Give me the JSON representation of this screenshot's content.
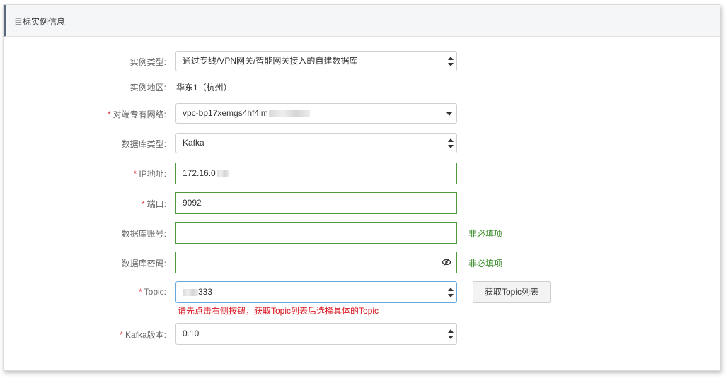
{
  "panel": {
    "title": "目标实例信息"
  },
  "form": {
    "instance_type": {
      "label": "实例类型:",
      "value": "通过专线/VPN网关/智能网关接入的自建数据库"
    },
    "region": {
      "label": "实例地区:",
      "value": "华东1（杭州）"
    },
    "vpc": {
      "required": "*",
      "label": "对端专有网络:",
      "value": "vpc-bp17xemgs4hf4lm"
    },
    "db_type": {
      "label": "数据库类型:",
      "value": "Kafka"
    },
    "ip": {
      "required": "*",
      "label": "IP地址:",
      "value": "172.16.0"
    },
    "port": {
      "required": "*",
      "label": "端口:",
      "value": "9092"
    },
    "account": {
      "label": "数据库账号:",
      "value": "",
      "hint": "非必填项"
    },
    "password": {
      "label": "数据库密码:",
      "value": "",
      "hint": "非必填项"
    },
    "topic": {
      "required": "*",
      "label": "Topic:",
      "value": "333",
      "button": "获取Topic列表",
      "error": "请先点击右侧按钮，获取Topic列表后选择具体的Topic"
    },
    "kafka_version": {
      "required": "*",
      "label": "Kafka版本:",
      "value": "0.10"
    }
  }
}
